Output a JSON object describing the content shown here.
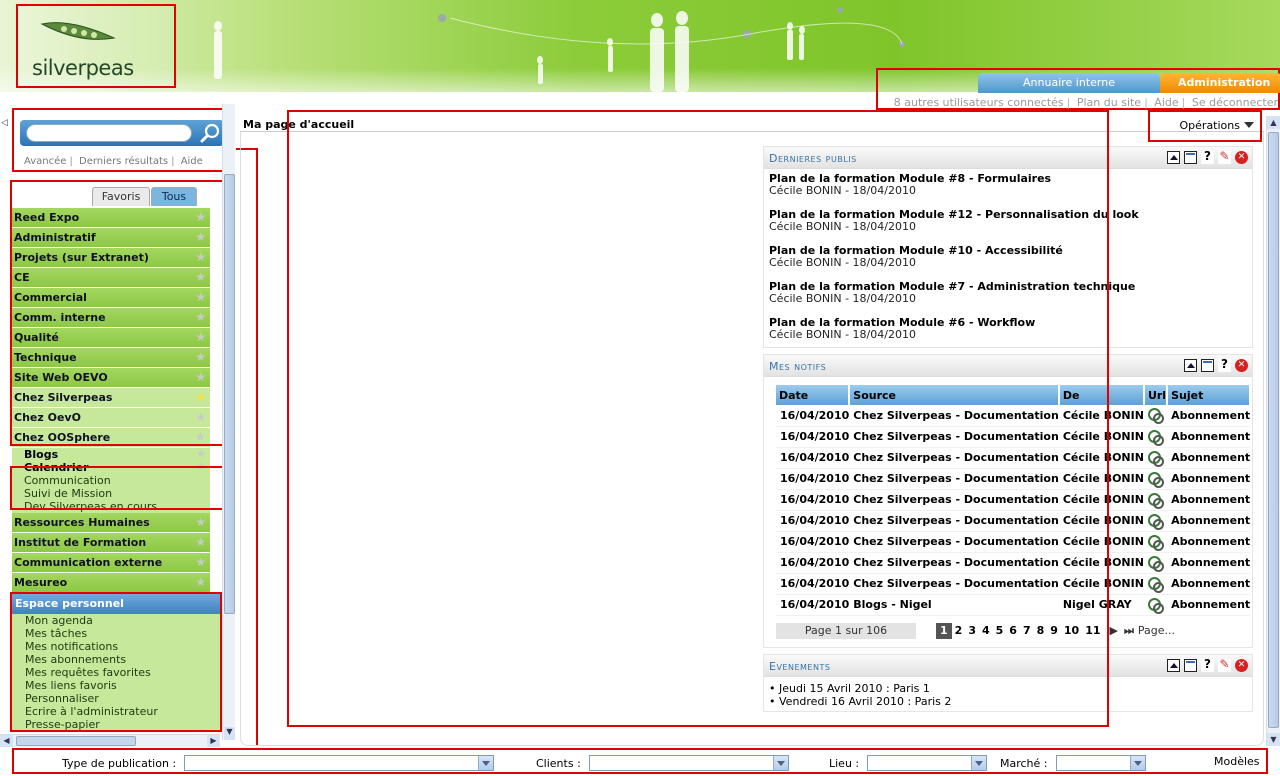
{
  "header": {
    "logo_text": "silverpeas",
    "tabs": [
      {
        "label": "Annuaire interne"
      },
      {
        "label": "Administration"
      }
    ],
    "links": [
      "8 autres utilisateurs connectés",
      "Plan du site",
      "Aide",
      "Se déconnecter"
    ]
  },
  "search": {
    "placeholder": "",
    "links": [
      "Avancée",
      "Derniers résultats",
      "Aide"
    ]
  },
  "sidebar_tabs": {
    "favoris": "Favoris",
    "tous": "Tous"
  },
  "spaces": [
    {
      "label": "Reed Expo",
      "favorite": false
    },
    {
      "label": "Administratif",
      "favorite": false
    },
    {
      "label": "Projets (sur Extranet)",
      "favorite": false
    },
    {
      "label": "CE",
      "favorite": false
    },
    {
      "label": "Commercial",
      "favorite": false
    },
    {
      "label": "Comm. interne",
      "favorite": false
    },
    {
      "label": "Qualité",
      "favorite": false
    },
    {
      "label": "Technique",
      "favorite": false
    },
    {
      "label": "Site Web OEVO",
      "favorite": false
    },
    {
      "label": "Chez Silverpeas",
      "favorite": true
    },
    {
      "label": "Chez OevO",
      "favorite": false
    },
    {
      "label": "Chez OOSphere",
      "favorite": false
    }
  ],
  "sub_spaces": [
    "Blogs",
    "Calendrier"
  ],
  "sub_links": [
    "Communication",
    "Suivi de Mission",
    "Dev Silverpeas en cours"
  ],
  "spaces_after": [
    {
      "label": "Ressources Humaines"
    },
    {
      "label": "Institut de Formation"
    },
    {
      "label": "Communication externe"
    },
    {
      "label": "Mesureo"
    }
  ],
  "perso": {
    "title": "Espace personnel",
    "links": [
      "Mon agenda",
      "Mes tâches",
      "Mes notifications",
      "Mes abonnements",
      "Mes requêtes favorites",
      "Mes liens favoris",
      "Personnaliser",
      "Ecrire à l'administrateur",
      "Presse-papier"
    ]
  },
  "main": {
    "page_title": "Ma page d'accueil",
    "operations": "Opérations"
  },
  "publis": {
    "title": "Dernieres publis",
    "items": [
      {
        "title": "Plan de la formation Module #8 - Formulaires",
        "meta": "Cécile BONIN - 18/04/2010"
      },
      {
        "title": "Plan de la formation Module #12 - Personnalisation du look",
        "meta": "Cécile BONIN - 18/04/2010"
      },
      {
        "title": "Plan de la formation Module #10 - Accessibilité",
        "meta": "Cécile BONIN - 18/04/2010"
      },
      {
        "title": "Plan de la formation Module #7 - Administration technique",
        "meta": "Cécile BONIN - 18/04/2010"
      },
      {
        "title": "Plan de la formation Module #6 - Workflow",
        "meta": "Cécile BONIN - 18/04/2010"
      }
    ]
  },
  "notifs": {
    "title": "Mes notifs",
    "columns": [
      "Date",
      "Source",
      "De",
      "Url",
      "Sujet"
    ],
    "rows": [
      {
        "date": "16/04/2010",
        "source": "Chez Silverpeas - Documentation",
        "de": "Cécile BONIN",
        "sujet": "Abonnement"
      },
      {
        "date": "16/04/2010",
        "source": "Chez Silverpeas - Documentation",
        "de": "Cécile BONIN",
        "sujet": "Abonnement"
      },
      {
        "date": "16/04/2010",
        "source": "Chez Silverpeas - Documentation",
        "de": "Cécile BONIN",
        "sujet": "Abonnement"
      },
      {
        "date": "16/04/2010",
        "source": "Chez Silverpeas - Documentation",
        "de": "Cécile BONIN",
        "sujet": "Abonnement"
      },
      {
        "date": "16/04/2010",
        "source": "Chez Silverpeas - Documentation",
        "de": "Cécile BONIN",
        "sujet": "Abonnement"
      },
      {
        "date": "16/04/2010",
        "source": "Chez Silverpeas - Documentation",
        "de": "Cécile BONIN",
        "sujet": "Abonnement"
      },
      {
        "date": "16/04/2010",
        "source": "Chez Silverpeas - Documentation",
        "de": "Cécile BONIN",
        "sujet": "Abonnement"
      },
      {
        "date": "16/04/2010",
        "source": "Chez Silverpeas - Documentation",
        "de": "Cécile BONIN",
        "sujet": "Abonnement"
      },
      {
        "date": "16/04/2010",
        "source": "Chez Silverpeas - Documentation",
        "de": "Cécile BONIN",
        "sujet": "Abonnement"
      },
      {
        "date": "16/04/2010",
        "source": "Blogs - Nigel",
        "de": "Nigel GRAY",
        "sujet": "Abonnement"
      }
    ],
    "pager_label": "Page 1 sur 106",
    "pages": [
      "1",
      "2",
      "3",
      "4",
      "5",
      "6",
      "7",
      "8",
      "9",
      "10",
      "11"
    ],
    "current_page": "1",
    "goto_label": "Page..."
  },
  "events": {
    "title": "Evenements",
    "items": [
      "Jeudi 15 Avril 2010 : Paris 1",
      "Vendredi 16 Avril 2010 : Paris 2"
    ]
  },
  "filters": [
    {
      "label": "Type de publication :",
      "value": ""
    },
    {
      "label": "Clients :",
      "value": ""
    },
    {
      "label": "Lieu :",
      "value": ""
    },
    {
      "label": "Marché :",
      "value": ""
    },
    {
      "label": "Modèles",
      "value": ""
    }
  ],
  "colors": {
    "accent_blue": "#3f82c0",
    "space_green": "#8cc844",
    "admin_orange": "#ef8a00",
    "annotation_red": "#e00000"
  }
}
